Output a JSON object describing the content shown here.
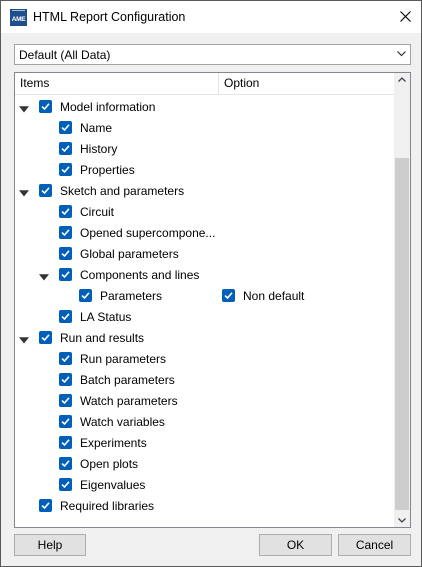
{
  "window": {
    "title": "HTML Report Configuration",
    "app_icon_text": "AME"
  },
  "preset": {
    "selected": "Default (All Data)"
  },
  "tree": {
    "columns": [
      "Items",
      "Option"
    ],
    "rows": [
      {
        "label": "Model information",
        "level": 0,
        "expander": "expanded",
        "checked": true
      },
      {
        "label": "Name",
        "level": 1,
        "expander": "none",
        "checked": true
      },
      {
        "label": "History",
        "level": 1,
        "expander": "none",
        "checked": true
      },
      {
        "label": "Properties",
        "level": 1,
        "expander": "none",
        "checked": true
      },
      {
        "label": "Sketch and parameters",
        "level": 0,
        "expander": "expanded",
        "checked": true
      },
      {
        "label": "Circuit",
        "level": 1,
        "expander": "none",
        "checked": true
      },
      {
        "label": "Opened supercompone...",
        "level": 1,
        "expander": "none",
        "checked": true
      },
      {
        "label": "Global parameters",
        "level": 1,
        "expander": "none",
        "checked": true
      },
      {
        "label": "Components and lines",
        "level": 1,
        "expander": "expanded",
        "checked": true
      },
      {
        "label": "Parameters",
        "level": 2,
        "expander": "none",
        "checked": true,
        "option": {
          "label": "Non default",
          "checked": true
        }
      },
      {
        "label": "LA Status",
        "level": 1,
        "expander": "none",
        "checked": true
      },
      {
        "label": "Run and results",
        "level": 0,
        "expander": "expanded",
        "checked": true
      },
      {
        "label": "Run parameters",
        "level": 1,
        "expander": "none",
        "checked": true
      },
      {
        "label": "Batch parameters",
        "level": 1,
        "expander": "none",
        "checked": true
      },
      {
        "label": "Watch parameters",
        "level": 1,
        "expander": "none",
        "checked": true
      },
      {
        "label": "Watch variables",
        "level": 1,
        "expander": "none",
        "checked": true
      },
      {
        "label": "Experiments",
        "level": 1,
        "expander": "none",
        "checked": true
      },
      {
        "label": "Open plots",
        "level": 1,
        "expander": "none",
        "checked": true
      },
      {
        "label": "Eigenvalues",
        "level": 1,
        "expander": "none",
        "checked": true
      },
      {
        "label": "Required libraries",
        "level": 0,
        "expander": "none",
        "checked": true
      }
    ]
  },
  "buttons": {
    "help": "Help",
    "ok": "OK",
    "cancel": "Cancel"
  },
  "colors": {
    "checkbox": "#005fb8",
    "button_face": "#e1e1e1",
    "dialog_bg": "#f0f0f0"
  },
  "icons": {
    "close": "close-icon",
    "dropdown": "chevron-down-icon",
    "expander": "triangle-down-icon",
    "scroll_up": "chevron-up-icon",
    "scroll_down": "chevron-down-icon"
  }
}
